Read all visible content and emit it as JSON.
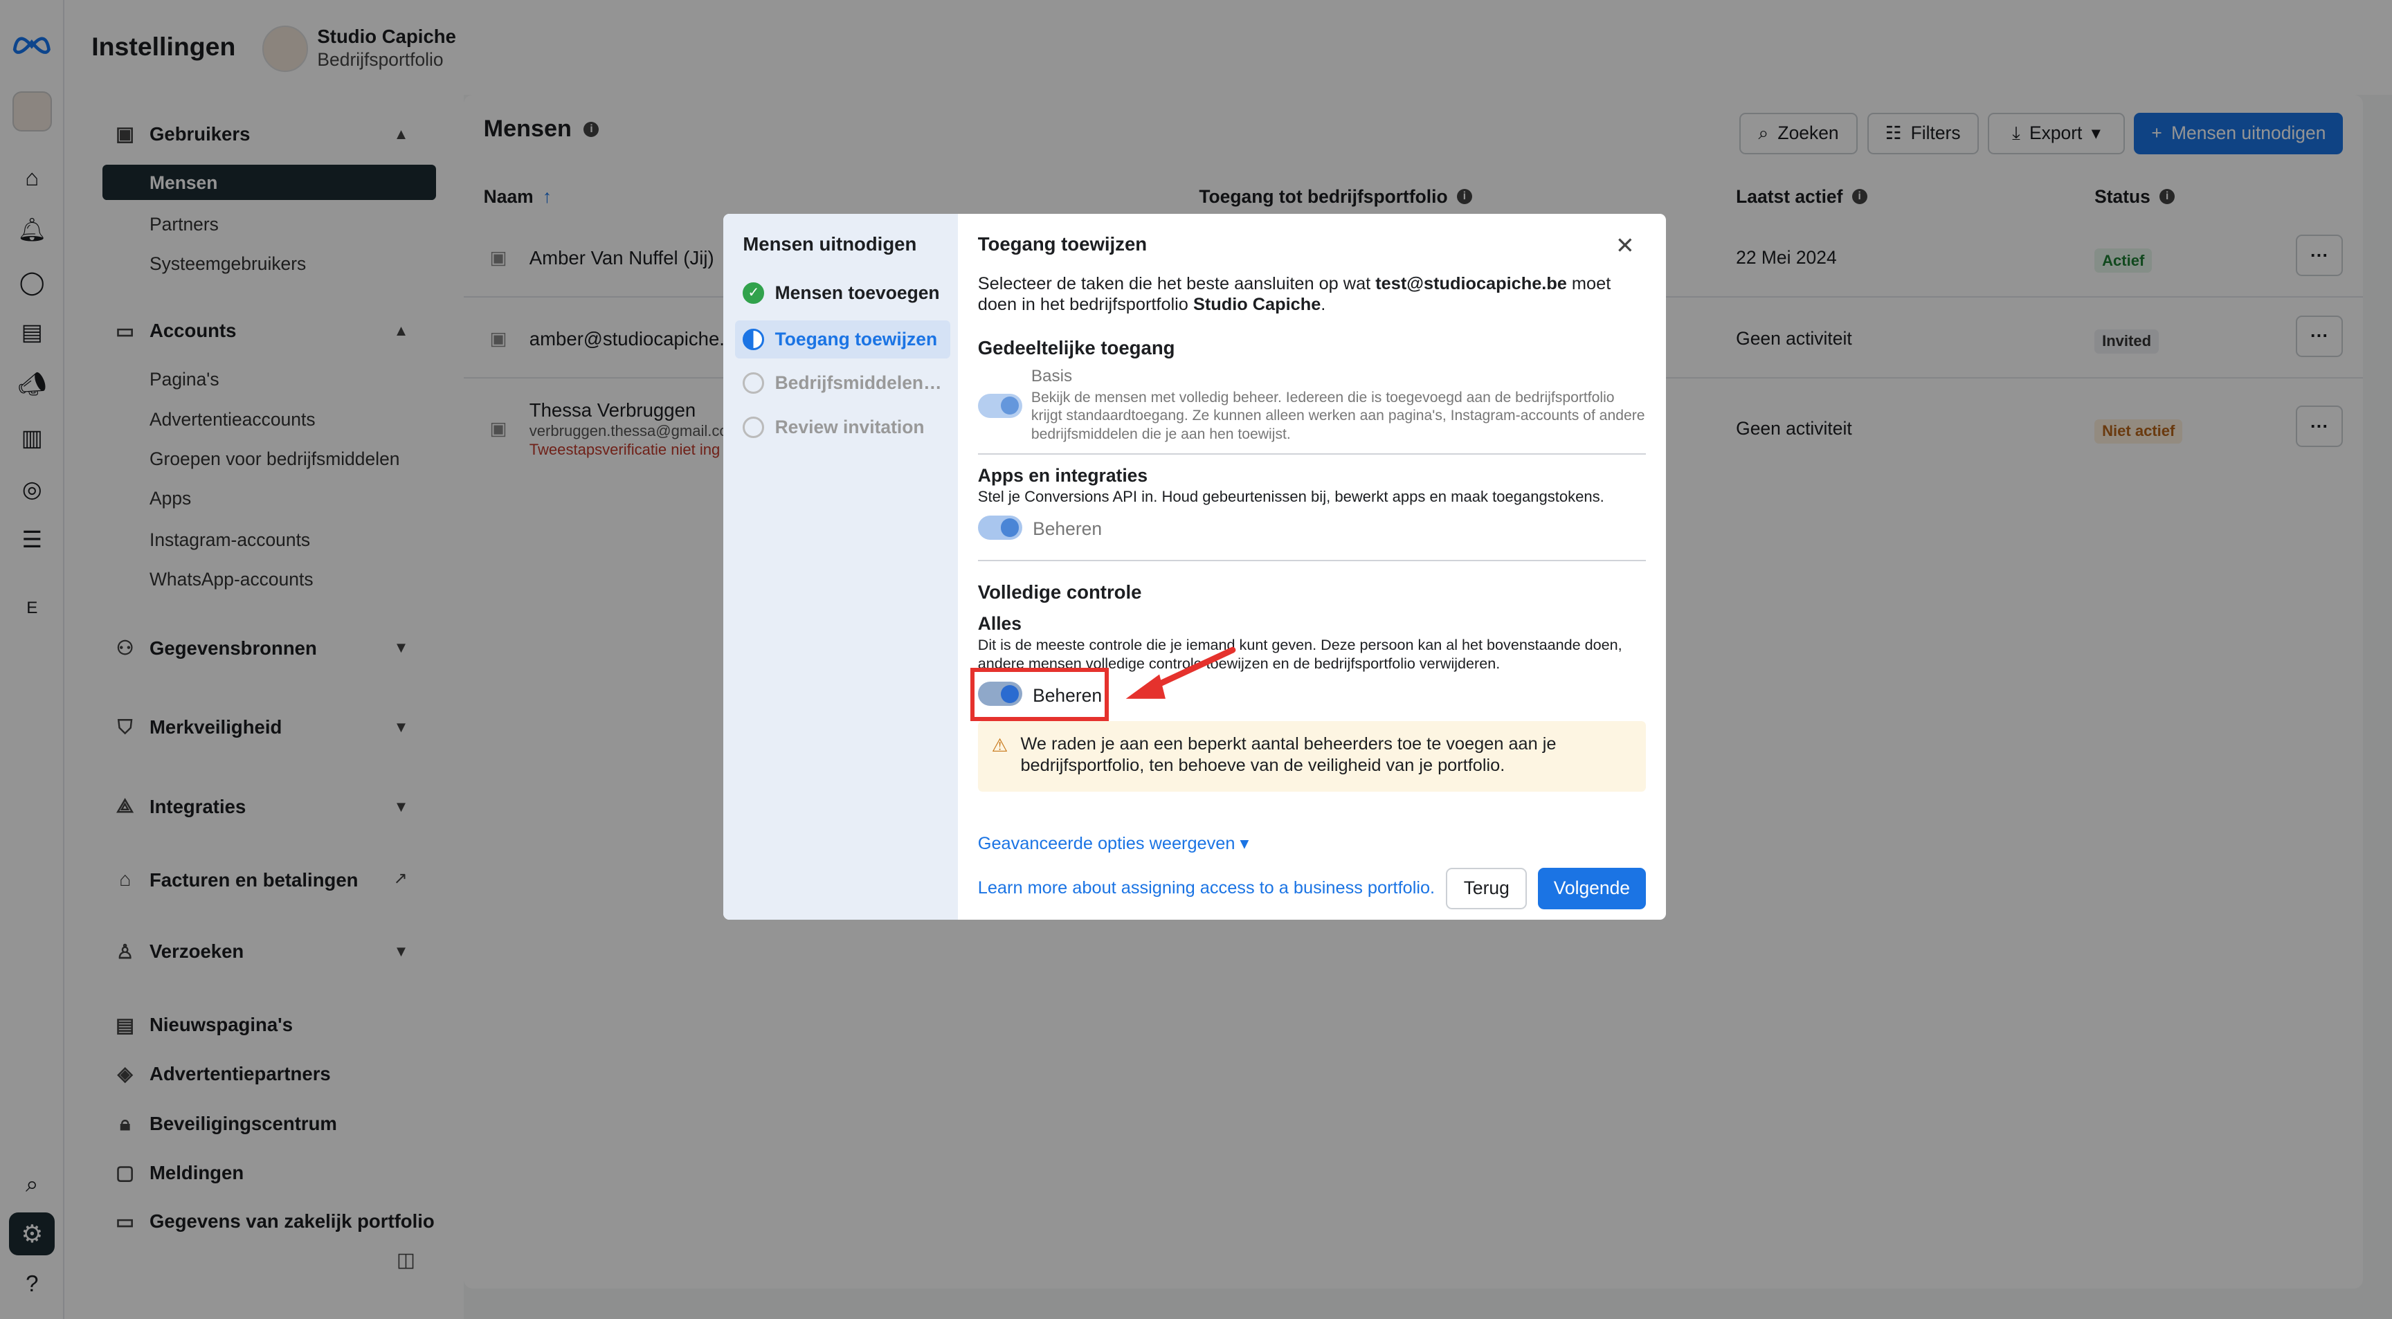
{
  "app": {
    "title": "Instellingen",
    "business_name": "Studio Capiche",
    "business_sub": "Bedrijfsportfolio"
  },
  "rail": {
    "icons": [
      "meta-logo",
      "business-avatar",
      "home-icon",
      "bell-icon",
      "chat-icon",
      "pages-icon",
      "megaphone-icon",
      "chart-icon",
      "compass-icon",
      "menu-icon"
    ],
    "letter": "E"
  },
  "sidebar": {
    "users": {
      "label": "Gebruikers",
      "items": [
        "Mensen",
        "Partners",
        "Systeemgebruikers"
      ]
    },
    "accounts": {
      "label": "Accounts",
      "items": [
        "Pagina's",
        "Advertentieaccounts",
        "Groepen voor bedrijfsmiddelen",
        "Apps",
        "Instagram-accounts",
        "WhatsApp-accounts"
      ]
    },
    "data_sources": "Gegevensbronnen",
    "brand_safety": "Merkveiligheid",
    "integrations": "Integraties",
    "billing": "Facturen en betalingen",
    "requests": "Verzoeken",
    "news_pages": "Nieuwspagina's",
    "ad_partners": "Advertentiepartners",
    "security": "Beveiligingscentrum",
    "notifications": "Meldingen",
    "business_info": "Gegevens van zakelijk portfolio"
  },
  "main": {
    "title": "Mensen",
    "search": "Zoeken",
    "filters": "Filters",
    "export": "Export",
    "invite": "Mensen uitnodigen",
    "columns": {
      "name": "Naam",
      "access": "Toegang tot bedrijfsportfolio",
      "last_active": "Laatst actief",
      "status": "Status"
    },
    "rows": [
      {
        "name": "Amber Van Nuffel (Jij)",
        "email": "",
        "note": "",
        "last": "22 Mei 2024",
        "status": "Actief"
      },
      {
        "name": "amber@studiocapiche.b",
        "email": "",
        "note": "",
        "last": "Geen activiteit",
        "status": "Invited"
      },
      {
        "name": "Thessa Verbruggen",
        "email": "verbruggen.thessa@gmail.co",
        "note": "Tweestapsverificatie niet ing",
        "last": "Geen activiteit",
        "status": "Niet actief"
      }
    ],
    "more_label": "···"
  },
  "modal": {
    "steps_title": "Mensen uitnodigen",
    "steps": [
      "Mensen toevoegen",
      "Toegang toewijzen",
      "Bedrijfsmiddelen…",
      "Review invitation"
    ],
    "heading": "Toegang toewijzen",
    "intro_1": "Selecteer de taken die het beste aansluiten op wat ",
    "intro_email": "test@studiocapiche.be",
    "intro_2": " moet doen in het bedrijfsportfolio ",
    "intro_biz": "Studio Capiche",
    "intro_end": ".",
    "partial": {
      "title": "Gedeeltelijke toegang",
      "basis": "Basis",
      "basis_desc": "Bekijk de mensen met volledig beheer. Iedereen die is toegevoegd aan de bedrijfsportfolio krijgt standaardtoegang. Ze kunnen alleen werken aan pagina's, Instagram-accounts of andere bedrijfsmiddelen die je aan hen toewijst."
    },
    "apps": {
      "title": "Apps en integraties",
      "desc": "Stel je Conversions API in. Houd gebeurtenissen bij, bewerkt apps en maak toegangstokens.",
      "toggle": "Beheren"
    },
    "full": {
      "title": "Volledige controle",
      "sub": "Alles",
      "desc": "Dit is de meeste controle die je iemand kunt geven. Deze persoon kan al het bovenstaande doen, andere mensen volledige controle toewijzen en de bedrijfsportfolio verwijderen.",
      "toggle": "Beheren"
    },
    "warning": "We raden je aan een beperkt aantal beheerders toe te voegen aan je bedrijfsportfolio, ten behoeve van de veiligheid van je portfolio.",
    "advanced": "Geavanceerde opties weergeven",
    "learn": "Learn more about assigning access to a business portfolio.",
    "back": "Terug",
    "next": "Volgende"
  },
  "colors": {
    "accent": "#1b74e4",
    "annotation": "#e5322d",
    "success": "#31a24c",
    "warning": "#c8781a"
  }
}
